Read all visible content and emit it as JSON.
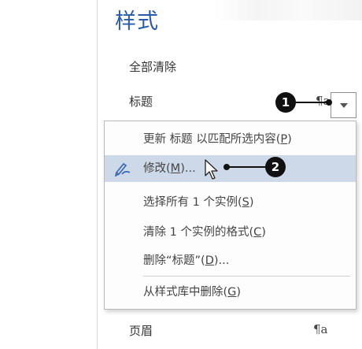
{
  "pane": {
    "title": "样式",
    "clear_all": "全部清除",
    "styles": [
      {
        "name": "标题",
        "mark": "¶a"
      },
      {
        "name": "页眉",
        "mark": "¶a"
      }
    ]
  },
  "callouts": [
    "1",
    "2"
  ],
  "context_menu": {
    "items": [
      {
        "pre": "更新 标题 以匹配所选内容(",
        "key": "P",
        "post": ")"
      },
      {
        "pre": "修改(",
        "key": "M",
        "post": ")..."
      },
      {
        "pre": "选择所有 1 个实例(",
        "key": "S",
        "post": ")"
      },
      {
        "pre": "清除 1 个实例的格式(",
        "key": "C",
        "post": ")"
      },
      {
        "pre": "删除“标题”(",
        "key": "D",
        "post": ")..."
      },
      {
        "pre": "从样式库中删除(",
        "key": "G",
        "post": ")"
      }
    ]
  },
  "icons": [
    "dropdown-arrow-icon",
    "pen-edit-icon",
    "mouse-cursor-icon"
  ],
  "colors": {
    "title": "#2b5ba8",
    "hover": "#cdd9e8",
    "callout": "#111111"
  }
}
